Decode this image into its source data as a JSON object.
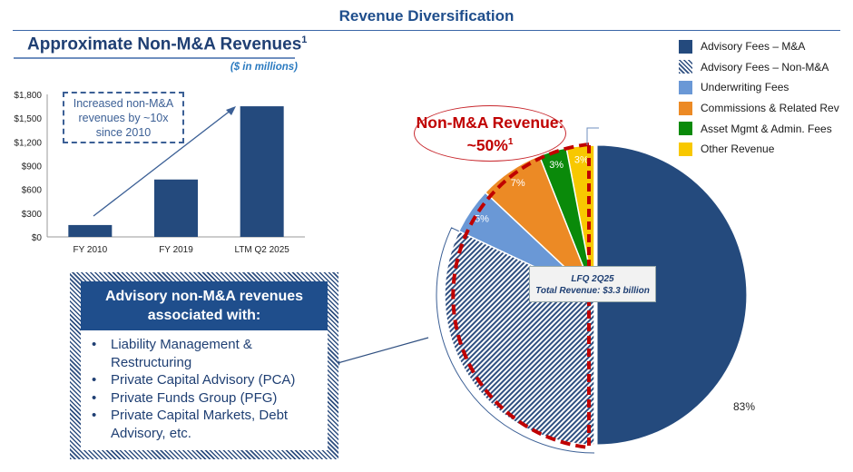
{
  "page_title": "Revenue Diversification",
  "left_panel": {
    "title": "Approximate Non-M&A Revenues",
    "title_footnote": "1",
    "units": "($ in millions)",
    "callout": "Increased non-M&A revenues by ~10x since 2010"
  },
  "assoc_box": {
    "heading": "Advisory non-M&A revenues associated with:",
    "items": [
      "Liability Management & Restructuring",
      "Private Capital Advisory (PCA)",
      "Private Funds Group (PFG)",
      "Private Capital Markets, Debt Advisory, etc."
    ]
  },
  "pie_panel": {
    "oval_line1": "Non-M&A Revenue:",
    "oval_line2": "~50%",
    "oval_footnote": "1",
    "center_line1": "LFQ 2Q25",
    "center_line2": "Total Revenue: $3.3 billion",
    "ma_label": "83%"
  },
  "colors": {
    "navy": "#244a7d",
    "light_blue": "#6a98d6",
    "orange": "#ec8a25",
    "green": "#0a8a0a",
    "yellow": "#f8c800",
    "red": "#c00000"
  },
  "chart_data": [
    {
      "type": "bar",
      "title": "Approximate Non-M&A Revenues",
      "categories": [
        "FY 2010",
        "FY 2019",
        "LTM Q2 2025"
      ],
      "values": [
        150,
        725,
        1650
      ],
      "ylim": [
        0,
        1800
      ],
      "yticks": [
        0,
        300,
        600,
        900,
        1200,
        1500,
        1800
      ],
      "ytick_labels": [
        "$0",
        "$300",
        "$600",
        "$900",
        "$1,200",
        "$1,500",
        "$1,800"
      ],
      "xlabel": "",
      "ylabel": ""
    },
    {
      "type": "pie",
      "title": "LFQ 2Q25 Total Revenue: $3.3 billion",
      "slices": [
        {
          "name": "Advisory Fees – M&A",
          "value": 50,
          "color": "#244a7d",
          "label": ""
        },
        {
          "name": "Advisory Fees – Non-M&A",
          "value": 32,
          "color": "hatch",
          "label": ""
        },
        {
          "name": "Underwriting Fees",
          "value": 5,
          "color": "#6a98d6",
          "label": "5%"
        },
        {
          "name": "Commissions & Related Rev",
          "value": 7,
          "color": "#ec8a25",
          "label": "7%"
        },
        {
          "name": "Asset Mgmt & Admin. Fees",
          "value": 3,
          "color": "#0a8a0a",
          "label": "3%"
        },
        {
          "name": "Other Revenue",
          "value": 3,
          "color": "#f8c800",
          "label": "3%"
        }
      ],
      "legend_position": "top-right"
    }
  ]
}
